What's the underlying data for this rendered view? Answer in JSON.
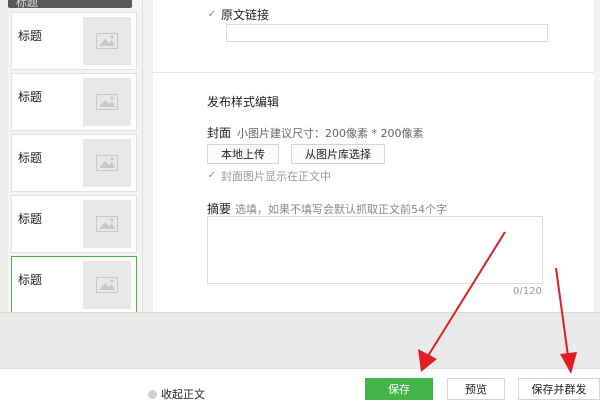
{
  "list": {
    "header_label": "标题",
    "items": [
      {
        "title": "标题",
        "thumb_icon": "image-placeholder-icon"
      },
      {
        "title": "标题",
        "thumb_icon": "image-placeholder-icon"
      },
      {
        "title": "标题",
        "thumb_icon": "image-placeholder-icon"
      },
      {
        "title": "标题",
        "thumb_icon": "image-placeholder-icon"
      },
      {
        "title": "标题",
        "thumb_icon": "image-placeholder-icon",
        "active": true
      }
    ]
  },
  "editor": {
    "original_link_label": "原文链接",
    "original_link_checked": true,
    "original_link_value": "",
    "section_title": "发布样式编辑",
    "cover_label": "封面",
    "cover_hint": "小图片建议尺寸：200像素 * 200像素",
    "upload_local_label": "本地上传",
    "from_library_label": "从图片库选择",
    "show_cover_label": "封面图片显示在正文中",
    "show_cover_checked": true,
    "summary_label": "摘要",
    "summary_hint": "选填，如果不填写会默认抓取正文前54个字",
    "summary_value": "",
    "summary_count": "0/120"
  },
  "toolbar": {
    "collapse_label": "收起正文",
    "save_label": "保存",
    "preview_label": "预览",
    "save_mass_label": "保存并群发"
  },
  "colors": {
    "accent": "#44b549",
    "annotation_arrow": "#e02020"
  }
}
